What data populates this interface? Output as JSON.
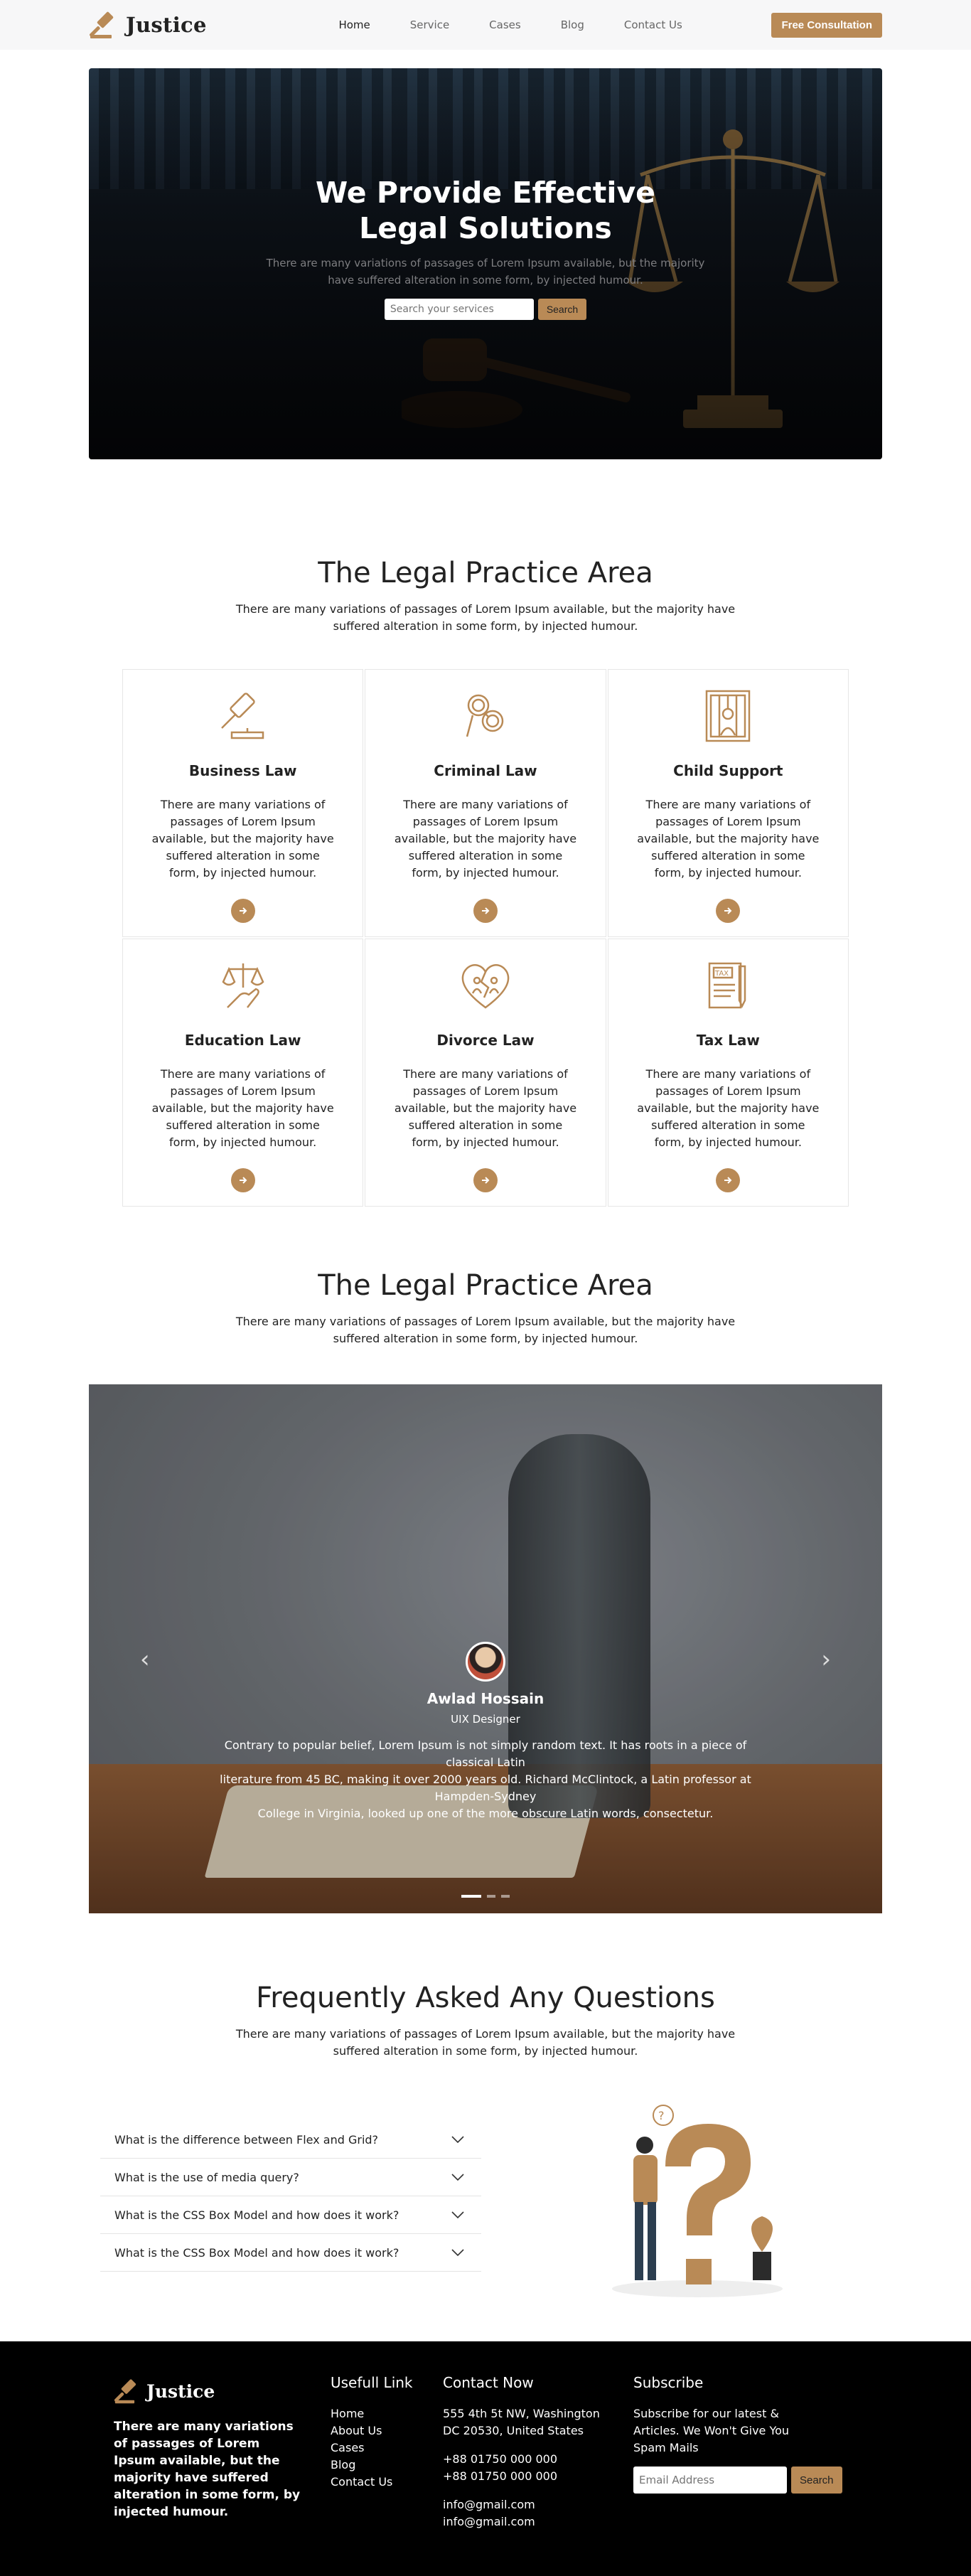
{
  "brand": {
    "name": "Justice",
    "accent": "#b98a56"
  },
  "nav": {
    "items": [
      {
        "label": "Home",
        "active": true
      },
      {
        "label": "Service"
      },
      {
        "label": "Cases"
      },
      {
        "label": "Blog"
      },
      {
        "label": "Contact Us"
      }
    ],
    "cta": "Free Consultation"
  },
  "hero": {
    "title_line1": "We Provide Effective",
    "title_line2": "Legal Solutions",
    "sub_line1": "There are many variations of passages of Lorem Ipsum available, but the majority",
    "sub_line2": "have suffered alteration in some form, by injected humour.",
    "search_placeholder": "Search your services",
    "search_button": "Search"
  },
  "practice": {
    "title": "The Legal Practice Area",
    "sub_line1": "There are many variations of passages of Lorem Ipsum available, but the majority have",
    "sub_line2": "suffered alteration in some form, by injected humour.",
    "cards": [
      {
        "title": "Business Law",
        "icon": "gavel-icon",
        "text": "There are many variations of passages of Lorem Ipsum available, but the majority have suffered alteration in some form, by injected humour."
      },
      {
        "title": "Criminal Law",
        "icon": "handcuffs-icon",
        "text": "There are many variations of passages of Lorem Ipsum available, but the majority have suffered alteration in some form, by injected humour."
      },
      {
        "title": "Child Support",
        "icon": "prison-icon",
        "text": "There are many variations of passages of Lorem Ipsum available, but the majority have suffered alteration in some form, by injected humour."
      },
      {
        "title": "Education Law",
        "icon": "scale-hand-icon",
        "text": "There are many variations of passages of Lorem Ipsum available, but the majority have suffered alteration in some form, by injected humour."
      },
      {
        "title": "Divorce Law",
        "icon": "broken-heart-icon",
        "text": "There are many variations of passages of Lorem Ipsum available, but the majority have suffered alteration in some form, by injected humour."
      },
      {
        "title": "Tax Law",
        "icon": "tax-document-icon",
        "text": "There are many variations of passages of Lorem Ipsum available, but the majority have suffered alteration in some form, by injected humour."
      }
    ]
  },
  "testimonial": {
    "title": "The Legal Practice Area",
    "sub_line1": "There are many variations of passages of Lorem Ipsum available, but the majority have",
    "sub_line2": "suffered alteration in some form, by injected humour.",
    "name": "Awlad Hossain",
    "role": "UIX Designer",
    "quote_line1": "Contrary to popular belief, Lorem Ipsum is not simply random text. It has roots in a piece of classical Latin",
    "quote_line2": "literature from 45 BC, making it over 2000 years old. Richard McClintock, a Latin professor at Hampden-Sydney",
    "quote_line3": "College in Virginia, looked up one of the more obscure Latin words, consectetur.",
    "dots": 3,
    "active_dot": 0
  },
  "faq": {
    "title": "Frequently Asked Any Questions",
    "sub_line1": "There are many variations of passages of Lorem Ipsum available, but the majority have",
    "sub_line2": "suffered alteration in some form, by injected humour.",
    "items": [
      "What is the difference between Flex and Grid?",
      "What is the use of media query?",
      "What is the CSS Box Model and how does it work?",
      "What is the CSS Box Model and how does it work?"
    ]
  },
  "footer": {
    "brand": "Justice",
    "about": "There are many variations of passages of Lorem Ipsum available, but the majority have suffered alteration in some form, by injected humour.",
    "links_title": "Usefull Link",
    "links": [
      "Home",
      "About Us",
      "Cases",
      "Blog",
      "Contact Us"
    ],
    "contact_title": "Contact Now",
    "address_line1": "555 4th 5t NW, Washington",
    "address_line2": "DC 20530, United States",
    "phone1": "+88 01750 000 000",
    "phone2": "+88 01750 000 000",
    "email1": "info@gmail.com",
    "email2": "info@gmail.com",
    "subscribe_title": "Subscribe",
    "subscribe_text": "Subscribe for our latest & Articles. We Won't Give You Spam Mails",
    "email_placeholder": "Email Address",
    "subscribe_button": "Search"
  }
}
